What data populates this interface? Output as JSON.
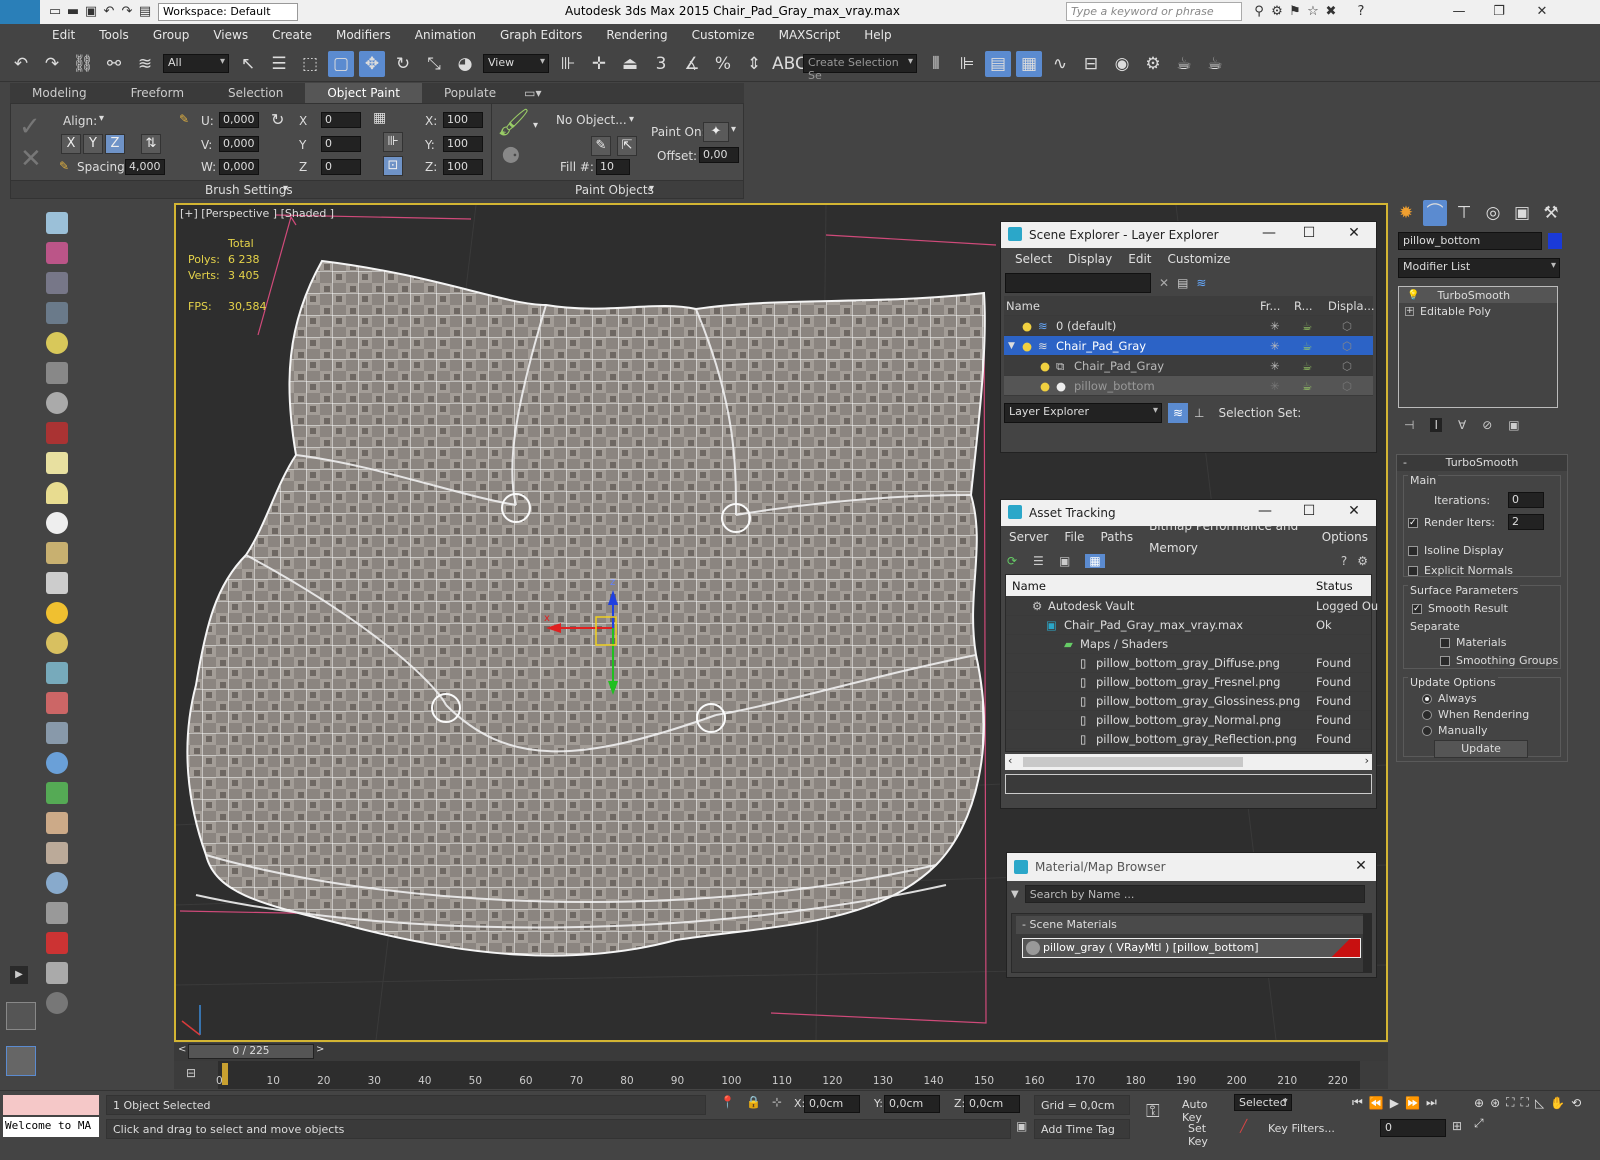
{
  "app": {
    "title": "Autodesk 3ds Max  2015      Chair_Pad_Gray_max_vray.max",
    "logo": "MAX",
    "workspace": "Workspace: Default",
    "search_placeholder": "Type a keyword or phrase"
  },
  "menu": [
    "Edit",
    "Tools",
    "Group",
    "Views",
    "Create",
    "Modifiers",
    "Animation",
    "Graph Editors",
    "Rendering",
    "Customize",
    "MAXScript",
    "Help"
  ],
  "toolbar": {
    "filter_value": "All",
    "refcoord_value": "View",
    "selection_set_placeholder": "Create Selection Se",
    "snap_label": "3"
  },
  "ribbon": {
    "tabs": [
      "Modeling",
      "Freeform",
      "Selection",
      "Object Paint",
      "Populate"
    ],
    "active_tab": "Object Paint",
    "align_label": "Align:",
    "axes": [
      "X",
      "Y",
      "Z"
    ],
    "spacing_label": "Spacing:",
    "spacing_value": "4,000",
    "u_label": "U:",
    "u_value": "0,000",
    "v_label": "V:",
    "v_value": "0,000",
    "w_label": "W:",
    "w_value": "0,000",
    "rx_label": "X",
    "rx_value": "0",
    "ry_label": "Y",
    "ry_value": "0",
    "rz_label": "Z",
    "rz_value": "0",
    "sx_label": "X:",
    "sx_value": "100",
    "sy_label": "Y:",
    "sy_value": "100",
    "sz_label": "Z:",
    "sz_value": "100",
    "no_object": "No Object...",
    "fill_label": "Fill #:",
    "fill_value": "10",
    "paint_on_label": "Paint On:",
    "offset_label": "Offset:",
    "offset_value": "0,00",
    "brush_settings": "Brush Settings",
    "paint_objects": "Paint Objects"
  },
  "viewport": {
    "label": "[+] [Perspective ] [Shaded ]",
    "stats_total": "Total",
    "polys_label": "Polys:",
    "polys_value": "6 238",
    "verts_label": "Verts:",
    "verts_value": "3 405",
    "fps_label": "FPS:",
    "fps_value": "30,584",
    "gizmo_x": "x",
    "gizmo_z": "z"
  },
  "scene_explorer": {
    "title": "Scene Explorer - Layer Explorer",
    "menu": [
      "Select",
      "Display",
      "Edit",
      "Customize"
    ],
    "columns": [
      "Name",
      "Fr...",
      "R...",
      "Displa..."
    ],
    "rows": [
      {
        "name": "0 (default)"
      },
      {
        "name": "Chair_Pad_Gray"
      },
      {
        "name": "Chair_Pad_Gray"
      },
      {
        "name": "pillow_bottom"
      }
    ],
    "footer_combo": "Layer Explorer",
    "selection_set": "Selection Set:"
  },
  "asset_tracking": {
    "title": "Asset Tracking",
    "menu": [
      "Server",
      "File",
      "Paths",
      "Bitmap Performance and Memory",
      "Options"
    ],
    "columns": [
      "Name",
      "Status"
    ],
    "rows": [
      {
        "name": "Autodesk Vault",
        "status": "Logged Ou"
      },
      {
        "name": "Chair_Pad_Gray_max_vray.max",
        "status": "Ok"
      },
      {
        "name": "Maps / Shaders",
        "status": ""
      },
      {
        "name": "pillow_bottom_gray_Diffuse.png",
        "status": "Found"
      },
      {
        "name": "pillow_bottom_gray_Fresnel.png",
        "status": "Found"
      },
      {
        "name": "pillow_bottom_gray_Glossiness.png",
        "status": "Found"
      },
      {
        "name": "pillow_bottom_gray_Normal.png",
        "status": "Found"
      },
      {
        "name": "pillow_bottom_gray_Reflection.png",
        "status": "Found"
      }
    ]
  },
  "material_browser": {
    "title": "Material/Map Browser",
    "search_placeholder": "Search by Name ...",
    "section": "- Scene Materials",
    "item": "pillow_gray  ( VRayMtl ) [pillow_bottom]"
  },
  "command_panel": {
    "object_name": "pillow_bottom",
    "modifier_list": "Modifier List",
    "stack": [
      "TurboSmooth",
      "Editable Poly"
    ],
    "rollout_title": "TurboSmooth",
    "main_label": "Main",
    "iterations_label": "Iterations:",
    "iterations_value": "0",
    "render_iters_label": "Render Iters:",
    "render_iters_value": "2",
    "isoline": "Isoline Display",
    "explicit_normals": "Explicit Normals",
    "surface_params": "Surface Parameters",
    "smooth_result": "Smooth Result",
    "separate": "Separate",
    "materials": "Materials",
    "smoothing_groups": "Smoothing Groups",
    "update_options": "Update Options",
    "always": "Always",
    "when_rendering": "When Rendering",
    "manually": "Manually",
    "update_button": "Update"
  },
  "timeline": {
    "frame_display": "0 / 225",
    "frame_progress": 0,
    "ticks": [
      "0",
      "10",
      "20",
      "30",
      "40",
      "50",
      "60",
      "70",
      "80",
      "90",
      "100",
      "110",
      "120",
      "130",
      "140",
      "150",
      "160",
      "170",
      "180",
      "190",
      "200",
      "210",
      "220"
    ]
  },
  "status": {
    "listener": "Welcome to MA",
    "selected": "1 Object Selected",
    "prompt": "Click and drag to select and move objects",
    "x_label": "X:",
    "x_value": "0,0cm",
    "y_label": "Y:",
    "y_value": "0,0cm",
    "z_label": "Z:",
    "z_value": "0,0cm",
    "grid": "Grid = 0,0cm",
    "add_time_tag": "Add Time Tag",
    "auto_key": "Auto Key",
    "set_key": "Set Key",
    "key_mode": "Selected",
    "key_filters": "Key Filters...",
    "current_frame": "0"
  },
  "colors": {
    "accent": "#5b8bd0",
    "viewport_border": "#d3b533",
    "selected_row": "#2c63c6",
    "stats_yellow": "#e5d34a"
  }
}
